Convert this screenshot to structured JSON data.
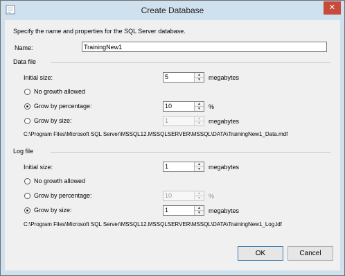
{
  "window": {
    "title": "Create Database",
    "close_glyph": "✕",
    "icon": "database-app-icon"
  },
  "intro": "Specify the name and properties for the SQL Server database.",
  "name": {
    "label": "Name:",
    "value": "TrainingNew1"
  },
  "data_file": {
    "section_label": "Data file",
    "initial_size": {
      "label": "Initial size:",
      "value": "5",
      "unit": "megabytes"
    },
    "no_growth_label": "No growth allowed",
    "grow_percent": {
      "label": "Grow by percentage:",
      "value": "10",
      "unit": "%",
      "selected": true
    },
    "grow_size": {
      "label": "Grow by size:",
      "value": "1",
      "unit": "megabytes",
      "selected": false
    },
    "path": "C:\\Program Files\\Microsoft SQL Server\\MSSQL12.MSSQLSERVER\\MSSQL\\DATA\\TrainingNew1_Data.mdf"
  },
  "log_file": {
    "section_label": "Log file",
    "initial_size": {
      "label": "Initial size:",
      "value": "1",
      "unit": "megabytes"
    },
    "no_growth_label": "No growth allowed",
    "grow_percent": {
      "label": "Grow by percentage:",
      "value": "10",
      "unit": "%",
      "selected": false
    },
    "grow_size": {
      "label": "Grow by size:",
      "value": "1",
      "unit": "megabytes",
      "selected": true
    },
    "path": "C:\\Program Files\\Microsoft SQL Server\\MSSQL12.MSSQLSERVER\\MSSQL\\DATA\\TrainingNew1_Log.ldf"
  },
  "buttons": {
    "ok": "OK",
    "cancel": "Cancel"
  },
  "spin_glyphs": {
    "up": "▲",
    "down": "▼"
  },
  "colors": {
    "title_bar": "#cfe0ee",
    "close_button": "#c74a3b",
    "dialog_body": "#f0f0f0"
  }
}
